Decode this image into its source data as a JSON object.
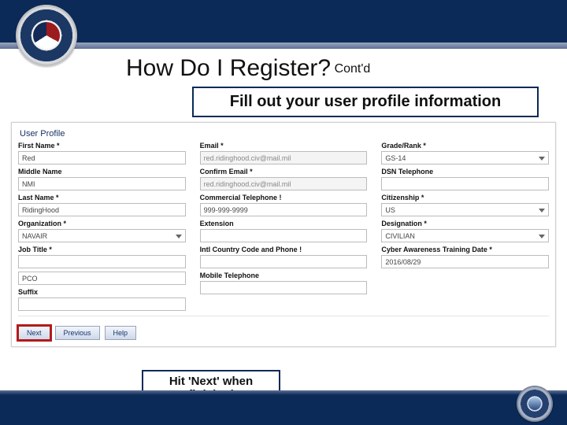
{
  "title": {
    "main": "How Do I Register?",
    "sub": "Cont'd"
  },
  "callouts": {
    "top": "Fill out your user profile information",
    "bottom": "Hit 'Next' when finished"
  },
  "section_title": "User Profile",
  "buttons": {
    "next": "Next",
    "previous": "Previous",
    "help": "Help"
  },
  "columns": [
    {
      "fields": [
        {
          "label": "First Name *",
          "value": "Red",
          "type": "text"
        },
        {
          "label": "Middle Name",
          "value": "NMI",
          "type": "text"
        },
        {
          "label": "Last Name *",
          "value": "RidingHood",
          "type": "text"
        },
        {
          "label": "Organization *",
          "value": "NAVAIR",
          "type": "dropdown"
        },
        {
          "label": "Job Title *",
          "value": "",
          "type": "text"
        },
        {
          "label": "",
          "value": "PCO",
          "type": "text"
        },
        {
          "label": "Suffix",
          "value": "",
          "type": "text"
        }
      ]
    },
    {
      "fields": [
        {
          "label": "Email *",
          "value": "red.ridinghood.civ@mail.mil",
          "type": "readonly"
        },
        {
          "label": "Confirm Email *",
          "value": "red.ridinghood.civ@mail.mil",
          "type": "readonly"
        },
        {
          "label": "Commercial Telephone !",
          "value": "999-999-9999",
          "type": "text"
        },
        {
          "label": "Extension",
          "value": "",
          "type": "text"
        },
        {
          "label": "Intl Country Code and Phone !",
          "value": "",
          "type": "text"
        },
        {
          "label": "Mobile Telephone",
          "value": "",
          "type": "text"
        }
      ]
    },
    {
      "fields": [
        {
          "label": "Grade/Rank *",
          "value": "GS-14",
          "type": "dropdown"
        },
        {
          "label": "DSN Telephone",
          "value": "",
          "type": "text"
        },
        {
          "label": "Citizenship *",
          "value": "US",
          "type": "dropdown"
        },
        {
          "label": "Designation *",
          "value": "CIVILIAN",
          "type": "dropdown"
        },
        {
          "label": "Cyber Awareness Training Date *",
          "value": "2016/08/29",
          "type": "text"
        }
      ]
    }
  ]
}
